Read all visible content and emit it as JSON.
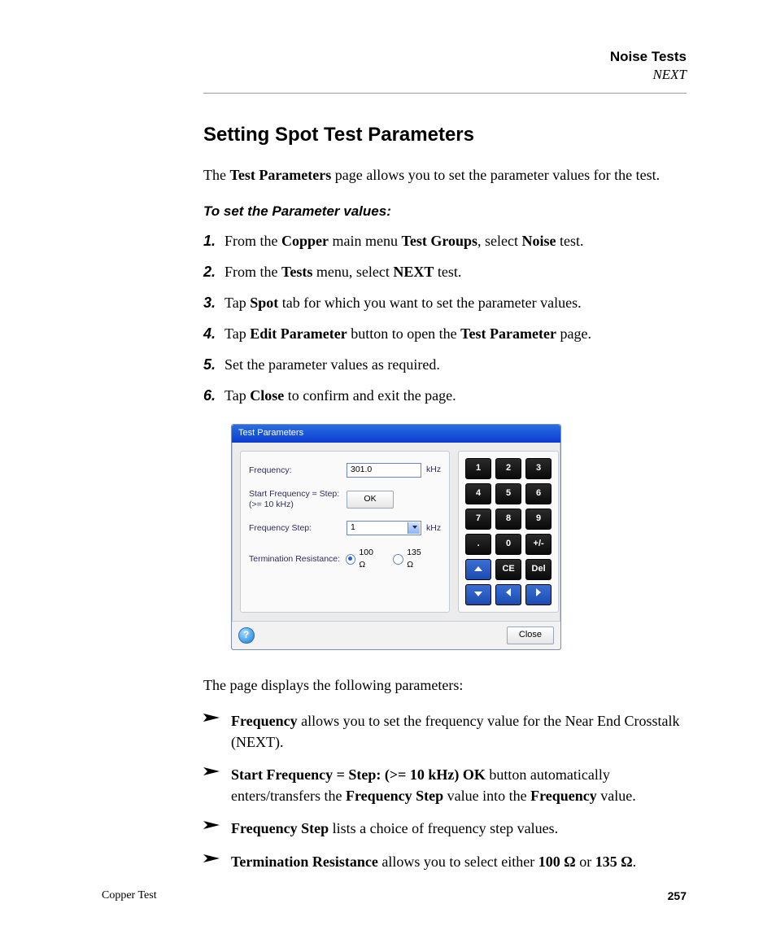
{
  "header": {
    "chapter": "Noise Tests",
    "section": "NEXT"
  },
  "section_title": "Setting Spot Test Parameters",
  "intro_1": "The ",
  "intro_b": "Test Parameters",
  "intro_2": " page allows you to set the parameter values for the test.",
  "subhead": "To set the Parameter values:",
  "steps": [
    {
      "n": "1.",
      "parts": [
        "From the ",
        "Copper",
        " main menu ",
        "Test Groups",
        ", select ",
        "Noise",
        " test."
      ]
    },
    {
      "n": "2.",
      "parts": [
        "From the ",
        "Tests",
        " menu, select ",
        "NEXT",
        " test."
      ]
    },
    {
      "n": "3.",
      "parts": [
        "Tap ",
        "Spot",
        " tab for which you want to set the parameter values."
      ]
    },
    {
      "n": "4.",
      "parts": [
        "Tap ",
        "Edit Parameter",
        " button to open the ",
        "Test Parameter",
        " page."
      ]
    },
    {
      "n": "5.",
      "plain": "Set the parameter values as required."
    },
    {
      "n": "6.",
      "parts": [
        "Tap ",
        "Close",
        " to confirm and exit the page."
      ]
    }
  ],
  "dialog": {
    "title": "Test Parameters",
    "rows": {
      "frequency_label": "Frequency:",
      "frequency_value": "301.0",
      "frequency_unit": "kHz",
      "start_label_1": "Start Frequency = Step:",
      "start_label_2": "(>= 10 kHz)",
      "ok_label": "OK",
      "step_label": "Frequency Step:",
      "step_value": "1",
      "step_unit": "kHz",
      "term_label": "Termination Resistance:",
      "term_opt1": "100 Ω",
      "term_opt2": "135 Ω"
    },
    "keypad": {
      "r1": [
        "1",
        "2",
        "3"
      ],
      "r2": [
        "4",
        "5",
        "6"
      ],
      "r3": [
        "7",
        "8",
        "9"
      ],
      "r4": [
        ".",
        "0",
        "+/-"
      ],
      "r5_ce": "CE",
      "r5_del": "Del"
    },
    "footer": {
      "close": "Close"
    }
  },
  "after_dialog": "The page displays the following parameters:",
  "bullets": [
    {
      "b": "Frequency",
      "rest": " allows you to set the frequency value for the Near End Crosstalk (NEXT)."
    },
    {
      "html": "start"
    },
    {
      "b": "Frequency Step",
      "rest": " lists a choice of frequency step values."
    },
    {
      "html": "term"
    }
  ],
  "start_bullet": {
    "b1": "Start Frequency = Step: (>= 10 kHz) OK",
    "mid1": " button automatically enters/transfers the ",
    "b2": "Frequency Step",
    "mid2": " value into the ",
    "b3": "Frequency",
    "mid3": " value."
  },
  "term_bullet": {
    "b1": "Termination Resistance",
    "mid1": " allows you to select either ",
    "b2": "100 Ω",
    "mid2": " or ",
    "b3": "135 Ω",
    "mid3": "."
  },
  "footer": {
    "left": "Copper Test",
    "right": "257"
  }
}
